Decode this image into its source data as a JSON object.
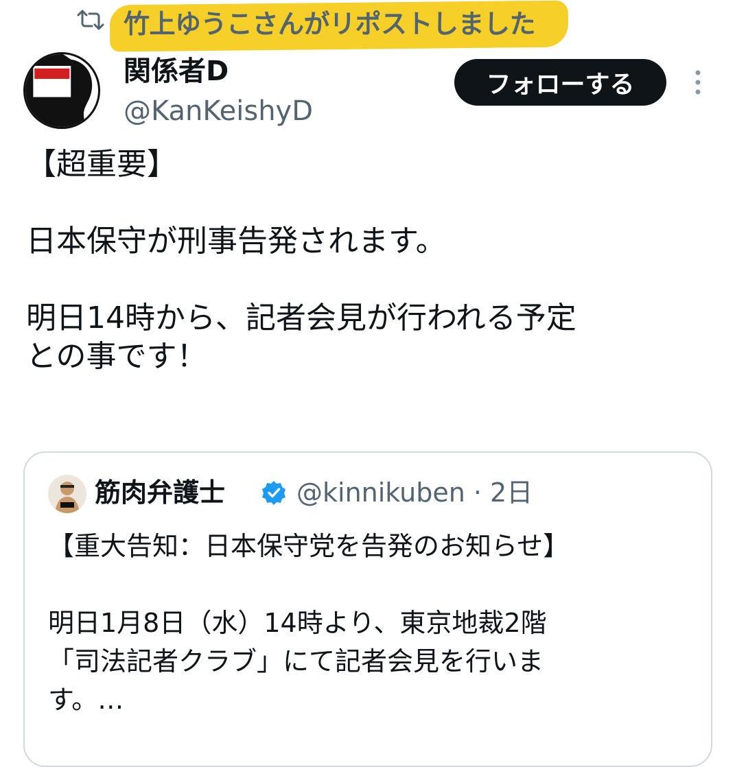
{
  "repost": {
    "icon": "repost-icon",
    "text": "竹上ゆうこさんがリポストしました",
    "highlight_color": "#f6cc1c"
  },
  "author": {
    "name": "関係者D",
    "handle": "@KanKeishyD",
    "avatar_text": "関係者D"
  },
  "actions": {
    "follow_label": "フォローする",
    "more_icon": "more-vertical-icon"
  },
  "tweet": {
    "text": "【超重要】\n\n日本保守が刑事告発されます。\n\n明日14時から、記者会見が行われる予定\nとの事です！"
  },
  "quoted": {
    "name": "筋肉弁護士",
    "verified_icon": "verified-badge-icon",
    "handle_time": "@kinnikuben · 2日",
    "text": "【重大告知：日本保守党を告発のお知らせ】\n\n明日1月8日（水）14時より、東京地裁2階\n「司法記者クラブ」にて記者会見を行いま\nす。…"
  },
  "colors": {
    "text_primary": "#0f1419",
    "text_secondary": "#536471",
    "verified_blue": "#1d9bf0",
    "border": "#cfd9de"
  }
}
